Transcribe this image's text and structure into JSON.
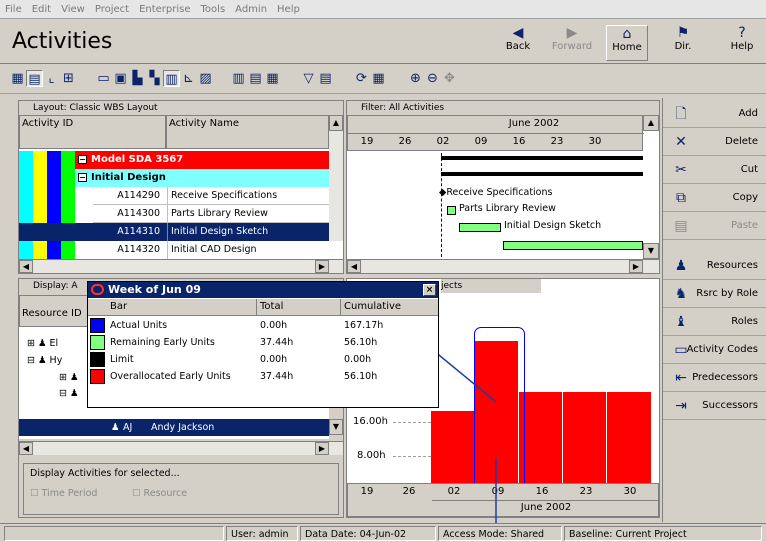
{
  "menu": [
    "File",
    "Edit",
    "View",
    "Project",
    "Enterprise",
    "Tools",
    "Admin",
    "Help"
  ],
  "page_title": "Activities",
  "nav": {
    "back": "Back",
    "forward": "Forward",
    "home": "Home",
    "dir": "Dir.",
    "help": "Help"
  },
  "layout": {
    "header": "Layout: Classic WBS Layout",
    "col_id": "Activity ID",
    "col_name": "Activity Name",
    "groups": [
      {
        "label": "Model SDA 3567"
      },
      {
        "label": "Initial Design"
      }
    ],
    "rows": [
      {
        "id": "A114290",
        "name": "Receive Specifications"
      },
      {
        "id": "A114300",
        "name": "Parts Library Review"
      },
      {
        "id": "A114310",
        "name": "Initial Design Sketch"
      },
      {
        "id": "A114320",
        "name": "Initial CAD Design"
      }
    ]
  },
  "filter": {
    "header": "Filter: All Activities",
    "month": "June 2002",
    "days": [
      "19",
      "26",
      "02",
      "09",
      "16",
      "23",
      "30"
    ]
  },
  "gantt_labels": [
    "Receive Specifications",
    "Parts Library Review",
    "Initial Design Sketch"
  ],
  "display": {
    "header": "Display: A",
    "col_resource": "Resource ID",
    "rows": [
      {
        "code": "El",
        "name": ""
      },
      {
        "code": "Hy",
        "name": ""
      },
      {
        "code": "AJ",
        "name": "Andy Jackson"
      }
    ],
    "display_activities": "Display Activities for selected...",
    "time_period": "Time Period",
    "resource": "Resource"
  },
  "histogram": {
    "header": "jects",
    "y_labels": [
      "16.00h",
      "8.00h"
    ],
    "days": [
      "19",
      "26",
      "02",
      "09",
      "16",
      "23",
      "30"
    ],
    "month": "June 2002"
  },
  "popup": {
    "title": "Week of Jun 09",
    "columns": [
      "Bar",
      "Total",
      "Cumulative"
    ],
    "rows": [
      {
        "label": "Actual Units",
        "total": "0.00h",
        "cumulative": "167.17h",
        "color": "#0000ff"
      },
      {
        "label": "Remaining Early Units",
        "total": "37.44h",
        "cumulative": "56.10h",
        "color": "#80ff80"
      },
      {
        "label": "Limit",
        "total": "0.00h",
        "cumulative": "0.00h",
        "color": "#000000"
      },
      {
        "label": "Overallocated Early Units",
        "total": "37.44h",
        "cumulative": "56.10h",
        "color": "#ff0000"
      }
    ]
  },
  "actions": [
    {
      "label": "Add",
      "icon": "new-document-icon",
      "enabled": true
    },
    {
      "label": "Delete",
      "icon": "x-delete-icon",
      "enabled": true
    },
    {
      "label": "Cut",
      "icon": "scissors-icon",
      "enabled": true
    },
    {
      "label": "Copy",
      "icon": "copy-icon",
      "enabled": true
    },
    {
      "label": "Paste",
      "icon": "paste-icon",
      "enabled": false
    },
    {
      "label": "Resources",
      "icon": "person-icon",
      "enabled": true
    },
    {
      "label": "Rsrc by Role",
      "icon": "rsrc-role-icon",
      "enabled": true
    },
    {
      "label": "Roles",
      "icon": "role-icon",
      "enabled": true
    },
    {
      "label": "Activity Codes",
      "icon": "activity-codes-icon",
      "enabled": true
    },
    {
      "label": "Predecessors",
      "icon": "predecessors-icon",
      "enabled": true
    },
    {
      "label": "Successors",
      "icon": "successors-icon",
      "enabled": true
    }
  ],
  "status": {
    "user": "User: admin",
    "data_date": "Data Date: 04-Jun-02",
    "access": "Access Mode: Shared",
    "baseline": "Baseline: Current Project"
  },
  "colors": {
    "selection": "#0a246a",
    "project": "#ff0000",
    "wbs": "#80ffff",
    "bar": "#ff0000",
    "gantt_bar": "#80ff80"
  }
}
